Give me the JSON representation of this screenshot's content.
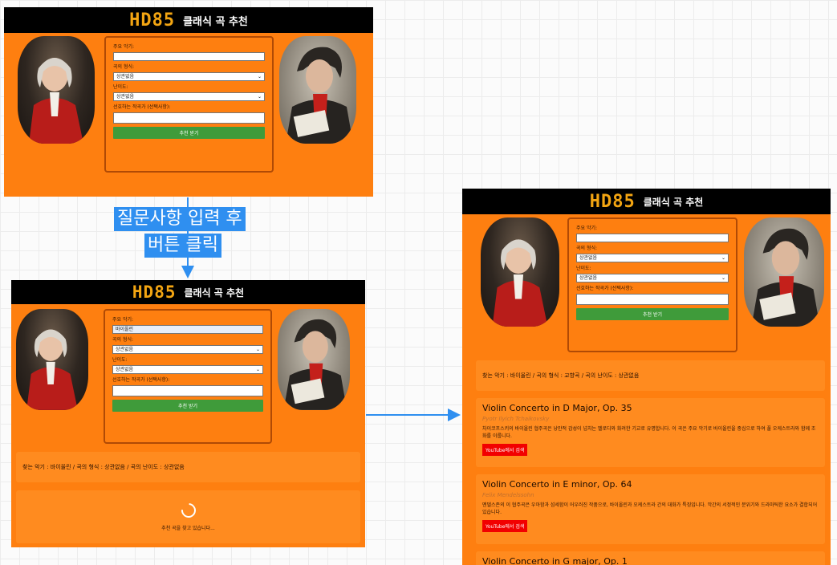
{
  "app": {
    "logo": "HD85",
    "title": "클래식 곡 추천"
  },
  "form": {
    "instrument_label": "주요 악기:",
    "form_label": "곡의 형식:",
    "difficulty_label": "난이도:",
    "composer_label": "선호하는 작곡가 (선택사항):",
    "submit_label": "추천 받기",
    "form_value_default": "상관없음",
    "difficulty_value_default": "상관없음",
    "instrument_value_filled": "바이올린"
  },
  "callout": {
    "line1": "질문사항 입력 후",
    "line2": "버튼 클릭"
  },
  "loading": {
    "summary": "찾는 악기 : 바이올린 / 곡의 형식 : 상관없음 / 곡의 난이도 : 상관없음",
    "message": "추천 곡을 찾고 있습니다..."
  },
  "results": {
    "summary": "찾는 악기 : 바이올린 / 곡의 형식 : 교향곡 / 곡의 난이도 : 상관없음",
    "youtube_label": "YouTube에서 검색",
    "items": [
      {
        "title": "Violin Concerto in D Major, Op. 35",
        "composer": "Pyotr Ilyich Tchaikovsky",
        "desc": "차이코프스키의 바이올린 협주곡은 낭만적 감성이 넘치는 멜로디와 화려한 기교로 유명합니다. 이 곡은 주요 악기로 바이올린을 중심으로 하여 풀 오케스트라와 함께 조화를 이룹니다."
      },
      {
        "title": "Violin Concerto in E minor, Op. 64",
        "composer": "Felix Mendelssohn",
        "desc": "멘델스존의 이 협주곡은 우아함과 섬세함이 어우러진 작품으로, 바이올린과 오케스트라 간의 대화가 특징입니다. 악간의 서정적인 분위기와 드라마틱한 요소가 결합되어 있습니다."
      },
      {
        "title": "Violin Concerto in G major, Op. 1"
      }
    ]
  },
  "colors": {
    "frame": "#fe7f10",
    "header": "#000000",
    "button": "#3f9b3a",
    "youtube": "#f20000",
    "callout": "#2f8ff0",
    "arrow": "#2f8ff0"
  }
}
